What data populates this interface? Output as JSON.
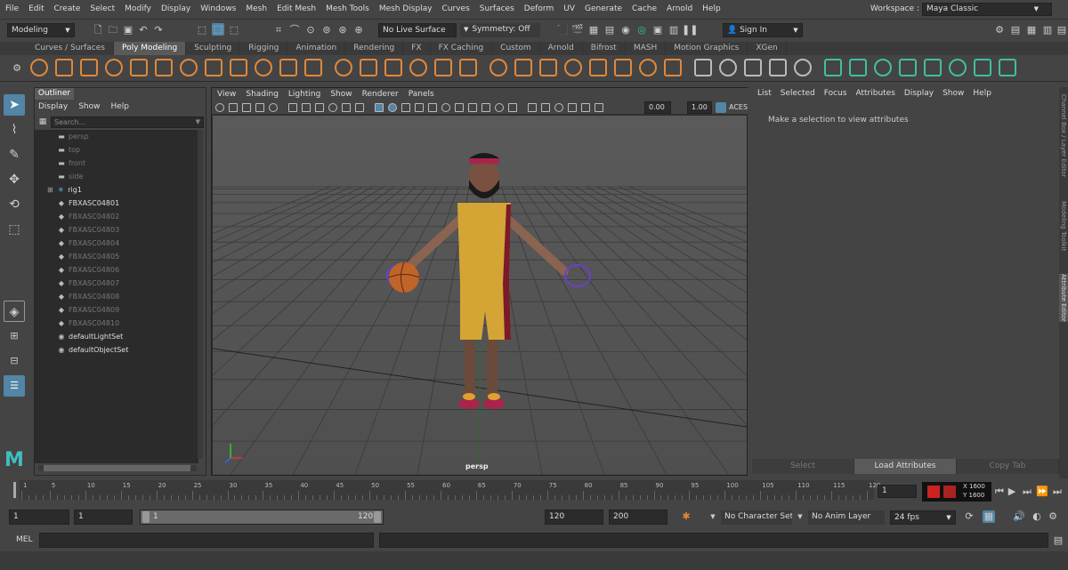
{
  "menubar": {
    "items": [
      "File",
      "Edit",
      "Create",
      "Select",
      "Modify",
      "Display",
      "Windows",
      "Mesh",
      "Edit Mesh",
      "Mesh Tools",
      "Mesh Display",
      "Curves",
      "Surfaces",
      "Deform",
      "UV",
      "Generate",
      "Cache",
      "Arnold",
      "Help"
    ],
    "workspace_label": "Workspace :",
    "workspace_value": "Maya Classic"
  },
  "statusline": {
    "mode": "Modeling",
    "live_surface": "No Live Surface",
    "symmetry": "Symmetry: Off",
    "sign_in": "Sign In"
  },
  "shelf": {
    "tabs": [
      "Curves / Surfaces",
      "Poly Modeling",
      "Sculpting",
      "Rigging",
      "Animation",
      "Rendering",
      "FX",
      "FX Caching",
      "Custom",
      "Arnold",
      "Bifrost",
      "MASH",
      "Motion Graphics",
      "XGen"
    ],
    "active_tab": "Poly Modeling",
    "accent": "#e0883a",
    "green": "#3fbfa0"
  },
  "outliner": {
    "tab": "Outliner",
    "menu": [
      "Display",
      "Show",
      "Help"
    ],
    "search_placeholder": "Search...",
    "items": [
      {
        "label": "persp",
        "icon": "camera-icon",
        "dim": true
      },
      {
        "label": "top",
        "icon": "camera-icon",
        "dim": true
      },
      {
        "label": "front",
        "icon": "camera-icon",
        "dim": true
      },
      {
        "label": "side",
        "icon": "camera-icon",
        "dim": true
      },
      {
        "label": "rig1",
        "icon": "joint-icon",
        "dim": false,
        "expand": true
      },
      {
        "label": "FBXASC04801",
        "icon": "mesh-icon",
        "dim": false
      },
      {
        "label": "FBXASC04802",
        "icon": "mesh-icon",
        "dim": true
      },
      {
        "label": "FBXASC04803",
        "icon": "mesh-icon",
        "dim": true
      },
      {
        "label": "FBXASC04804",
        "icon": "mesh-icon",
        "dim": true
      },
      {
        "label": "FBXASC04805",
        "icon": "mesh-icon",
        "dim": true
      },
      {
        "label": "FBXASC04806",
        "icon": "mesh-icon",
        "dim": true
      },
      {
        "label": "FBXASC04807",
        "icon": "mesh-icon",
        "dim": true
      },
      {
        "label": "FBXASC04808",
        "icon": "mesh-icon",
        "dim": true
      },
      {
        "label": "FBXASC04809",
        "icon": "mesh-icon",
        "dim": true
      },
      {
        "label": "FBXASC04810",
        "icon": "mesh-icon",
        "dim": true
      },
      {
        "label": "defaultLightSet",
        "icon": "set-icon",
        "dim": false
      },
      {
        "label": "defaultObjectSet",
        "icon": "set-icon",
        "dim": false
      }
    ]
  },
  "viewport": {
    "menu": [
      "View",
      "Shading",
      "Lighting",
      "Show",
      "Renderer",
      "Panels"
    ],
    "exposure": "0.00",
    "gamma": "1.00",
    "color_space": "ACES",
    "camera_label": "persp"
  },
  "attribute_editor": {
    "menu": [
      "List",
      "Selected",
      "Focus",
      "Attributes",
      "Display",
      "Show",
      "Help"
    ],
    "message": "Make a selection to view attributes",
    "buttons": [
      "Select",
      "Load Attributes",
      "Copy Tab"
    ]
  },
  "side_tabs": [
    "Channel Box / Layer Editor",
    "Modeling Toolkit",
    "Attribute Editor"
  ],
  "timeline": {
    "ticks": [
      "1",
      "5",
      "10",
      "15",
      "20",
      "25",
      "30",
      "35",
      "40",
      "45",
      "50",
      "55",
      "60",
      "65",
      "70",
      "75",
      "80",
      "85",
      "90",
      "95",
      "100",
      "105",
      "110",
      "115",
      "120"
    ],
    "current_frame": "1",
    "readout_x": "X 1600",
    "readout_y": "Y 1600"
  },
  "range": {
    "start": "1",
    "playback_start": "1",
    "slider_start": "1",
    "slider_end": "120",
    "playback_end": "120",
    "end": "200",
    "character_set": "No Character Set",
    "anim_layer": "No Anim Layer",
    "fps": "24 fps"
  },
  "command_line": {
    "label": "MEL"
  }
}
